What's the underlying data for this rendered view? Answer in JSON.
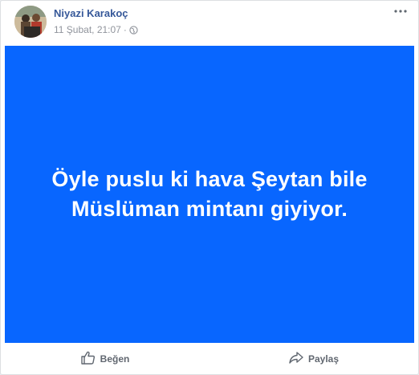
{
  "post": {
    "author": "Niyazi Karakoç",
    "timestamp": "11 Şubat, 21:07",
    "separator": "·",
    "privacy_icon": "globe-icon",
    "background_color": "#0866ff",
    "text_line_1": "Öyle puslu ki hava Şeytan bile",
    "text_line_2": "Müslüman mintanı giyiyor."
  },
  "actions": {
    "like_label": "Beğen",
    "like_icon": "thumbs-up-icon",
    "share_label": "Paylaş",
    "share_icon": "share-arrow-icon"
  },
  "menu": {
    "icon": "more-options-icon"
  },
  "colors": {
    "author_link": "#365899",
    "meta_text": "#90949c",
    "action_text": "#616770"
  }
}
